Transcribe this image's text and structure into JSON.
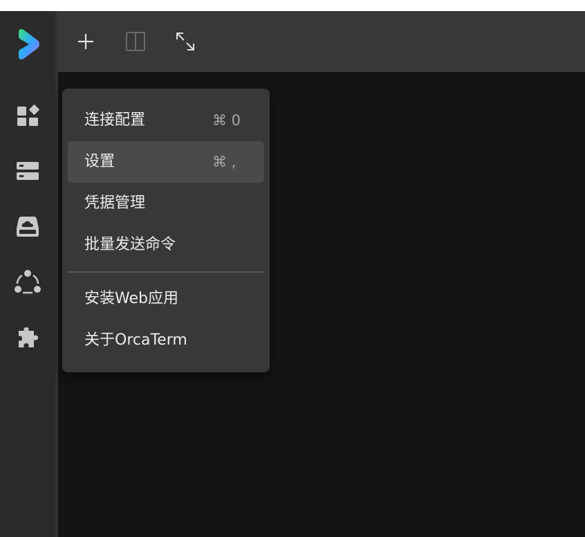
{
  "toolbar": {
    "icons": [
      "plus-icon",
      "split-view-icon",
      "expand-icon"
    ]
  },
  "sidebar": {
    "icons": [
      "dashboard-icon",
      "server-icon",
      "cloud-storage-icon",
      "share-network-icon",
      "puzzle-icon"
    ]
  },
  "menu": {
    "items": [
      {
        "label": "连接配置",
        "shortcut": "⌘ 0"
      },
      {
        "label": "设置",
        "shortcut": "⌘ ,"
      },
      {
        "label": "凭据管理",
        "shortcut": ""
      },
      {
        "label": "批量发送命令",
        "shortcut": ""
      },
      {
        "label": "安装Web应用",
        "shortcut": ""
      },
      {
        "label": "关于OrcaTerm",
        "shortcut": ""
      }
    ],
    "active_index": 1
  },
  "colors": {
    "sidebar_bg": "#2b2b2b",
    "toolbar_bg": "#383838",
    "content_bg": "#141414",
    "menu_bg": "#383838",
    "menu_active_bg": "#4a4a4a",
    "icon": "#c8c8c8"
  }
}
